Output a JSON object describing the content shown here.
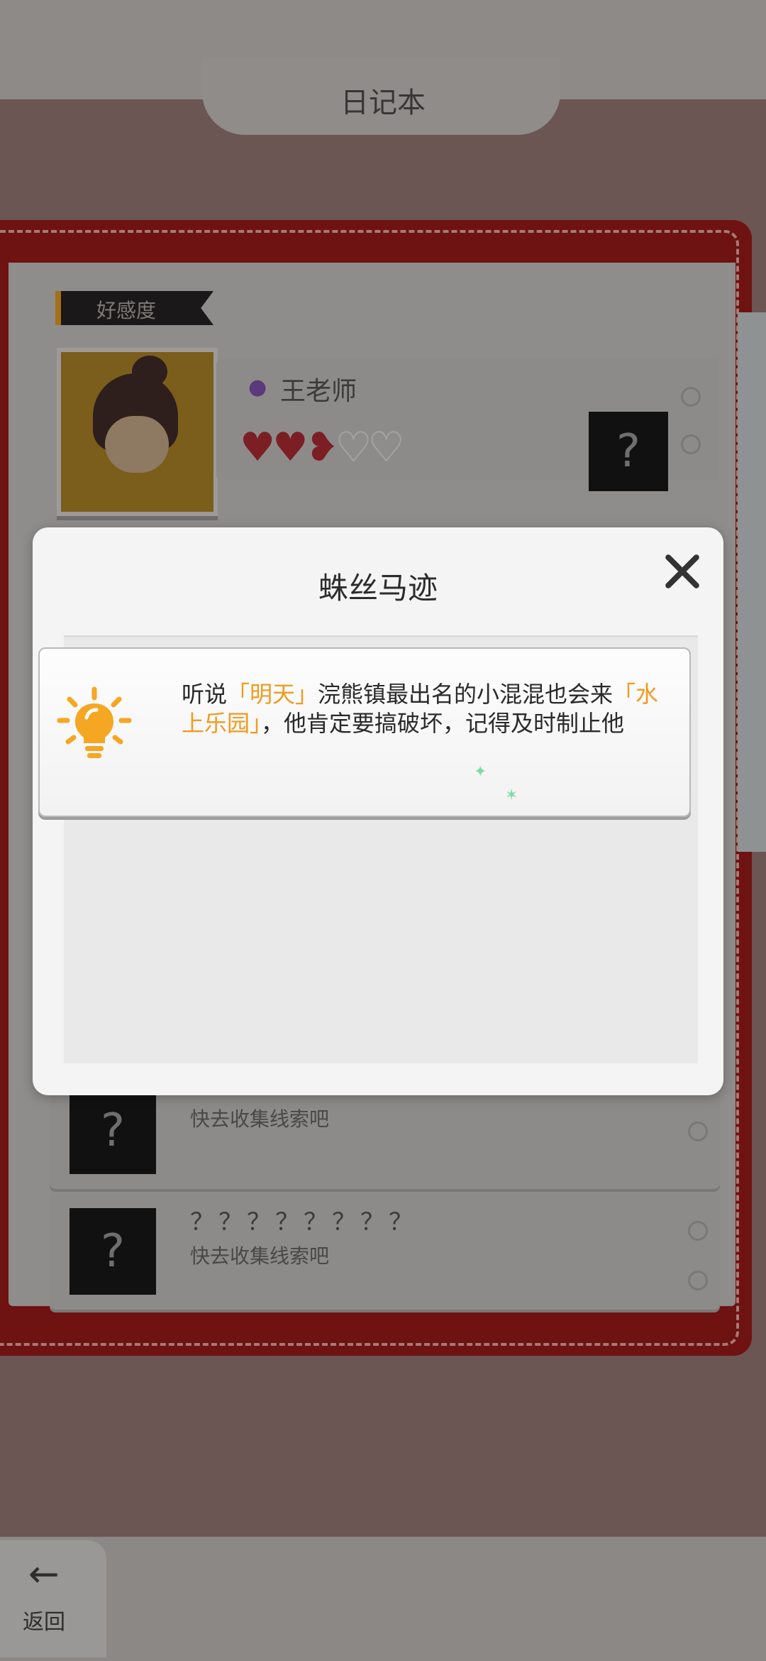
{
  "diary": {
    "title": "日记本",
    "section_label": "好感度",
    "npc": {
      "name": "王老师",
      "hearts_filled": 2.5,
      "hearts_total": 5
    },
    "mystery_mark": "?",
    "rows": [
      {
        "name": "",
        "hint": "快去收集线索吧"
      },
      {
        "name": "？？？？？？？？",
        "hint": "快去收集线索吧"
      }
    ]
  },
  "nav": {
    "back_label": "返回"
  },
  "modal": {
    "title": "蛛丝马迹",
    "clue": {
      "icon": "lightbulb-icon",
      "segments": [
        {
          "text": "听说",
          "highlight": false
        },
        {
          "text": "「明天」",
          "highlight": true
        },
        {
          "text": "浣熊镇最出名的小混混也会来",
          "highlight": false
        },
        {
          "text": "「水上乐园」",
          "highlight": true
        },
        {
          "text": "，他肯定要搞破坏，记得及时制止他",
          "highlight": false
        }
      ]
    }
  },
  "colors": {
    "highlight": "#f29a1e",
    "icon_orange": "#f5a623",
    "book_red": "#6e1212"
  }
}
